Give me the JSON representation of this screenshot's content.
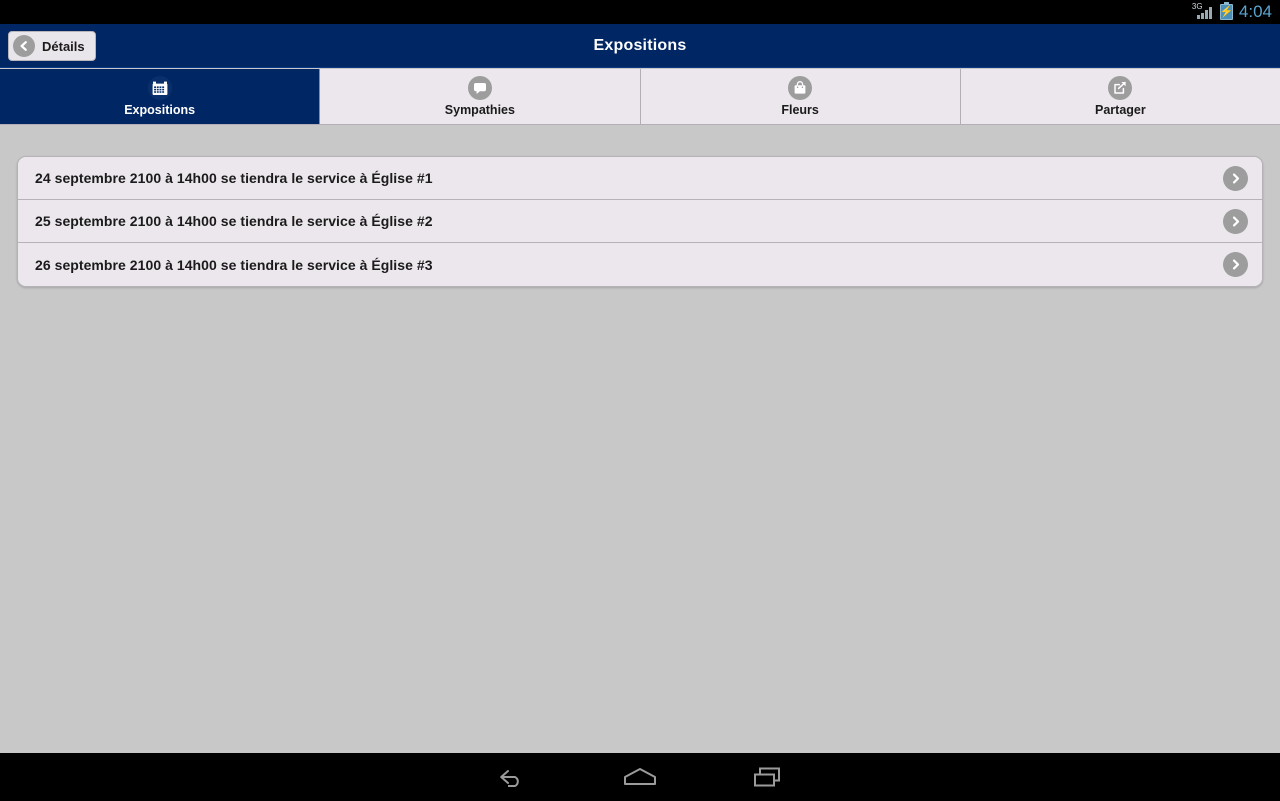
{
  "status_bar": {
    "network_label": "3G",
    "signal_icon": "signal-bars-icon",
    "battery_icon": "battery-charging-icon",
    "clock": "4:04",
    "clock_color": "#5ba4cf"
  },
  "title_bar": {
    "title": "Expositions",
    "back_button_label": "Détails",
    "back_icon": "chevron-left-icon",
    "background_color": "#002663"
  },
  "tabs": [
    {
      "label": "Expositions",
      "icon": "calendar-icon",
      "active": true
    },
    {
      "label": "Sympathies",
      "icon": "speech-bubble-icon",
      "active": false
    },
    {
      "label": "Fleurs",
      "icon": "shopping-bag-icon",
      "active": false
    },
    {
      "label": "Partager",
      "icon": "share-icon",
      "active": false
    }
  ],
  "list": {
    "rows": [
      {
        "text": "24 septembre 2100 à 14h00 se tiendra le service à Église #1",
        "chevron_icon": "chevron-right-icon"
      },
      {
        "text": "25 septembre 2100 à 14h00 se tiendra le service à Église #2",
        "chevron_icon": "chevron-right-icon"
      },
      {
        "text": "26 septembre 2100 à 14h00 se tiendra le service à Église #3",
        "chevron_icon": "chevron-right-icon"
      }
    ]
  },
  "nav_bar": {
    "buttons": [
      {
        "name": "back",
        "icon": "android-back-icon"
      },
      {
        "name": "home",
        "icon": "android-home-icon"
      },
      {
        "name": "recents",
        "icon": "android-recents-icon"
      }
    ]
  },
  "colors": {
    "page_background": "#c8c8c8",
    "surface": "#ebe7ec",
    "accent_navy": "#002663",
    "icon_gray": "#9d9d9d"
  }
}
